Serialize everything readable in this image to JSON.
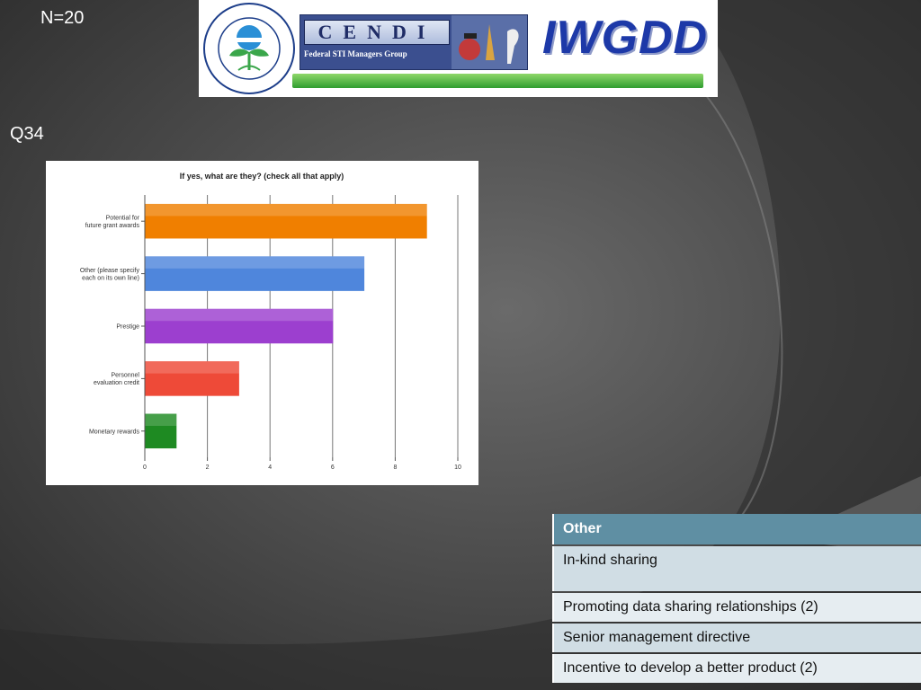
{
  "slide": {
    "n_label": "N=20",
    "question_label": "Q34"
  },
  "banner": {
    "epa_seal_text": "UNITED STATES ENVIRONMENTAL PROTECTION AGENCY",
    "cendi_word": "CENDI",
    "cendi_sub": "Federal STI Managers Group",
    "iwgdd_word": "IWGDD"
  },
  "chart_data": {
    "type": "bar",
    "orientation": "horizontal",
    "title": "If yes, what are they? (check all that apply)",
    "categories": [
      [
        "Potential for",
        "future grant awards"
      ],
      [
        "Other (please specify",
        "each on its own line)"
      ],
      [
        "Prestige"
      ],
      [
        "Personnel",
        "evaluation credit"
      ],
      [
        "Monetary rewards"
      ]
    ],
    "values": [
      9,
      7,
      6,
      3,
      1
    ],
    "bar_colors": [
      "#f07f00",
      "#4f86dc",
      "#9c3fcf",
      "#ee4a38",
      "#1e8a22"
    ],
    "xlim": [
      0,
      10
    ],
    "xticks": [
      "0",
      "2",
      "4",
      "6",
      "8",
      "10"
    ],
    "grid": true
  },
  "other_table": {
    "header": "Other",
    "rows": [
      "In-kind sharing",
      "Promoting data sharing relationships (2)",
      "Senior management directive",
      "Incentive to develop a better product (2)"
    ]
  }
}
